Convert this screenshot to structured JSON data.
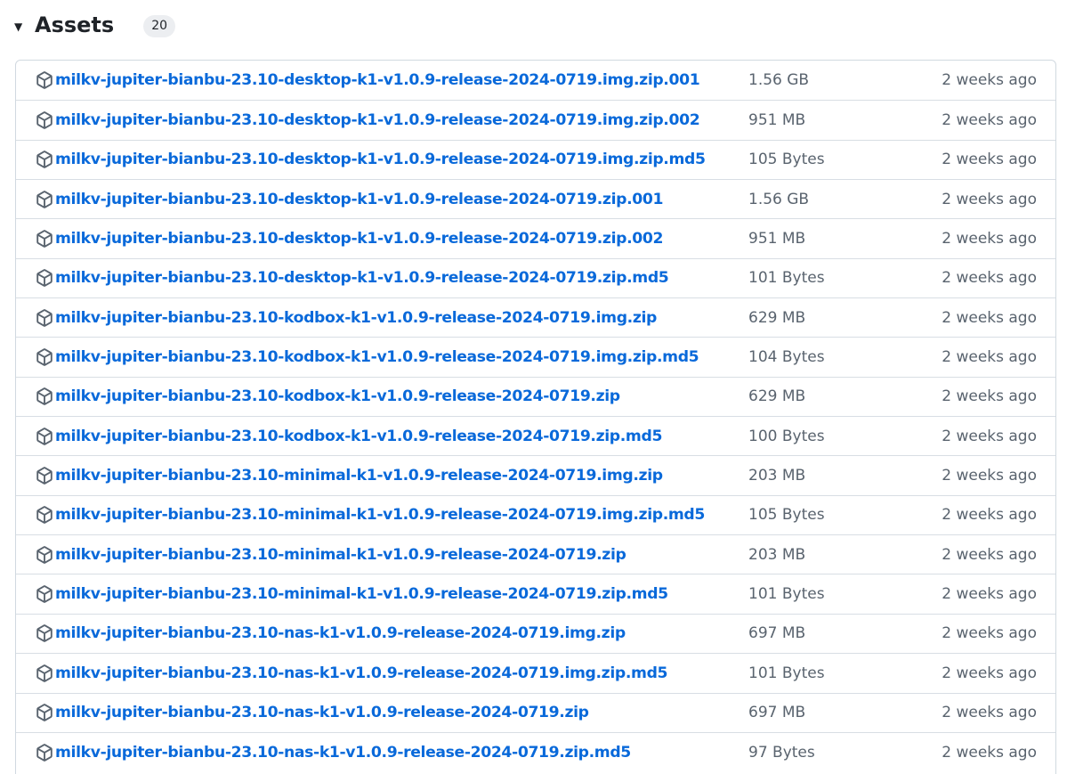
{
  "assets_section": {
    "title": "Assets",
    "count": "20",
    "caret_icon": "triangle-down-icon"
  },
  "colors": {
    "link": "#0969da",
    "muted_text": "#59636e",
    "border": "#d1d9e0",
    "badge_bg": "#eceef1"
  },
  "assets": [
    {
      "name": "milkv-jupiter-bianbu-23.10-desktop-k1-v1.0.9-release-2024-0719.img.zip.001",
      "size": "1.56 GB",
      "date": "2 weeks ago",
      "icon": "package-icon"
    },
    {
      "name": "milkv-jupiter-bianbu-23.10-desktop-k1-v1.0.9-release-2024-0719.img.zip.002",
      "size": "951 MB",
      "date": "2 weeks ago",
      "icon": "package-icon"
    },
    {
      "name": "milkv-jupiter-bianbu-23.10-desktop-k1-v1.0.9-release-2024-0719.img.zip.md5",
      "size": "105 Bytes",
      "date": "2 weeks ago",
      "icon": "package-icon"
    },
    {
      "name": "milkv-jupiter-bianbu-23.10-desktop-k1-v1.0.9-release-2024-0719.zip.001",
      "size": "1.56 GB",
      "date": "2 weeks ago",
      "icon": "package-icon"
    },
    {
      "name": "milkv-jupiter-bianbu-23.10-desktop-k1-v1.0.9-release-2024-0719.zip.002",
      "size": "951 MB",
      "date": "2 weeks ago",
      "icon": "package-icon"
    },
    {
      "name": "milkv-jupiter-bianbu-23.10-desktop-k1-v1.0.9-release-2024-0719.zip.md5",
      "size": "101 Bytes",
      "date": "2 weeks ago",
      "icon": "package-icon"
    },
    {
      "name": "milkv-jupiter-bianbu-23.10-kodbox-k1-v1.0.9-release-2024-0719.img.zip",
      "size": "629 MB",
      "date": "2 weeks ago",
      "icon": "package-icon"
    },
    {
      "name": "milkv-jupiter-bianbu-23.10-kodbox-k1-v1.0.9-release-2024-0719.img.zip.md5",
      "size": "104 Bytes",
      "date": "2 weeks ago",
      "icon": "package-icon"
    },
    {
      "name": "milkv-jupiter-bianbu-23.10-kodbox-k1-v1.0.9-release-2024-0719.zip",
      "size": "629 MB",
      "date": "2 weeks ago",
      "icon": "package-icon"
    },
    {
      "name": "milkv-jupiter-bianbu-23.10-kodbox-k1-v1.0.9-release-2024-0719.zip.md5",
      "size": "100 Bytes",
      "date": "2 weeks ago",
      "icon": "package-icon"
    },
    {
      "name": "milkv-jupiter-bianbu-23.10-minimal-k1-v1.0.9-release-2024-0719.img.zip",
      "size": "203 MB",
      "date": "2 weeks ago",
      "icon": "package-icon"
    },
    {
      "name": "milkv-jupiter-bianbu-23.10-minimal-k1-v1.0.9-release-2024-0719.img.zip.md5",
      "size": "105 Bytes",
      "date": "2 weeks ago",
      "icon": "package-icon"
    },
    {
      "name": "milkv-jupiter-bianbu-23.10-minimal-k1-v1.0.9-release-2024-0719.zip",
      "size": "203 MB",
      "date": "2 weeks ago",
      "icon": "package-icon"
    },
    {
      "name": "milkv-jupiter-bianbu-23.10-minimal-k1-v1.0.9-release-2024-0719.zip.md5",
      "size": "101 Bytes",
      "date": "2 weeks ago",
      "icon": "package-icon"
    },
    {
      "name": "milkv-jupiter-bianbu-23.10-nas-k1-v1.0.9-release-2024-0719.img.zip",
      "size": "697 MB",
      "date": "2 weeks ago",
      "icon": "package-icon"
    },
    {
      "name": "milkv-jupiter-bianbu-23.10-nas-k1-v1.0.9-release-2024-0719.img.zip.md5",
      "size": "101 Bytes",
      "date": "2 weeks ago",
      "icon": "package-icon"
    },
    {
      "name": "milkv-jupiter-bianbu-23.10-nas-k1-v1.0.9-release-2024-0719.zip",
      "size": "697 MB",
      "date": "2 weeks ago",
      "icon": "package-icon"
    },
    {
      "name": "milkv-jupiter-bianbu-23.10-nas-k1-v1.0.9-release-2024-0719.zip.md5",
      "size": "97 Bytes",
      "date": "2 weeks ago",
      "icon": "package-icon"
    }
  ]
}
